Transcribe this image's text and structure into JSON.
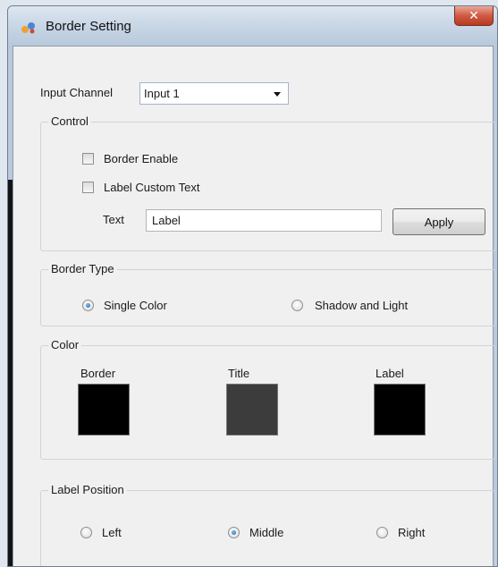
{
  "window": {
    "title": "Border Setting",
    "close_glyph": "✕"
  },
  "input_channel": {
    "label": "Input Channel",
    "value": "Input 1"
  },
  "control": {
    "title": "Control",
    "border_enable": {
      "label": "Border Enable",
      "checked": false
    },
    "label_custom_text": {
      "label": "Label Custom Text",
      "checked": false
    },
    "text_label": "Text",
    "text_value": "Label",
    "apply_label": "Apply"
  },
  "border_type": {
    "title": "Border Type",
    "options": [
      {
        "label": "Single Color",
        "selected": true
      },
      {
        "label": "Shadow and Light",
        "selected": false
      }
    ]
  },
  "color": {
    "title": "Color",
    "swatches": [
      {
        "label": "Border",
        "color": "#000000"
      },
      {
        "label": "Title",
        "color": "#3c3c3c"
      },
      {
        "label": "Label",
        "color": "#000000"
      }
    ]
  },
  "label_position": {
    "title": "Label Position",
    "options": [
      {
        "label": "Left",
        "selected": false
      },
      {
        "label": "Middle",
        "selected": true
      },
      {
        "label": "Right",
        "selected": false
      }
    ]
  }
}
